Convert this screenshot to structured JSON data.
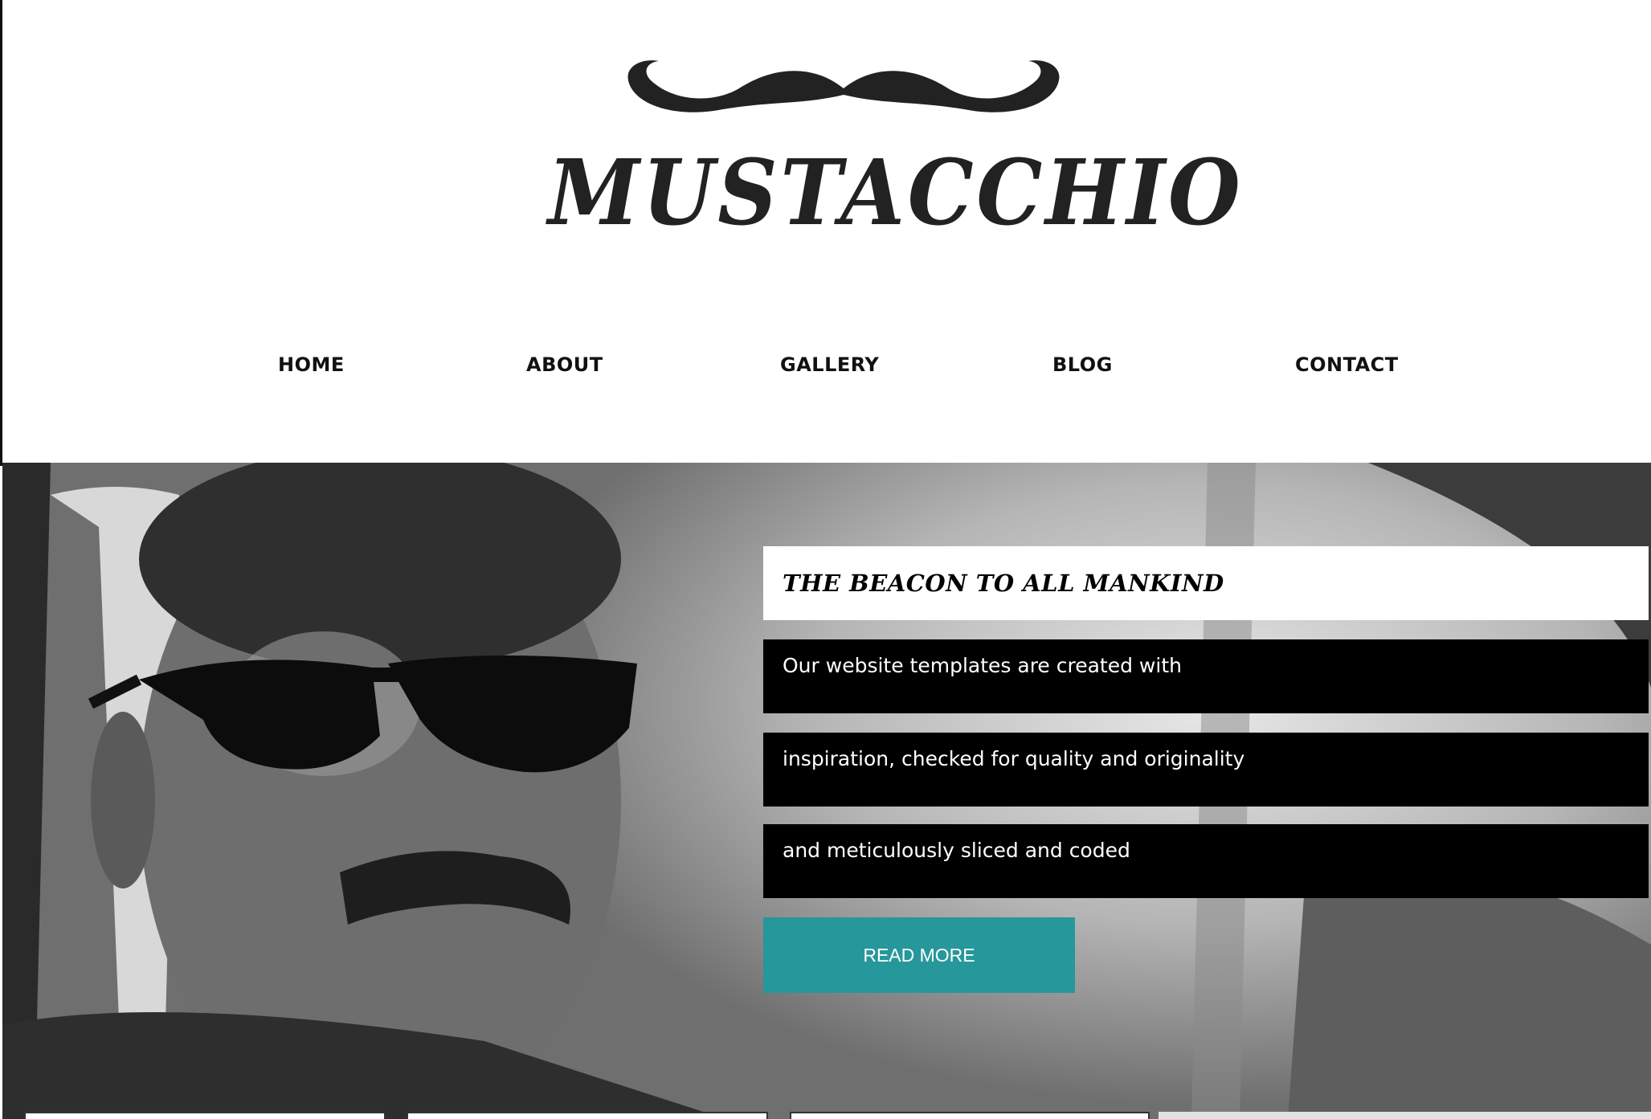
{
  "site": {
    "logo_text": "MUSTACCHIO"
  },
  "nav": {
    "items": [
      {
        "label": "HOME"
      },
      {
        "label": "ABOUT"
      },
      {
        "label": "GALLERY"
      },
      {
        "label": "BLOG"
      },
      {
        "label": "CONTACT"
      }
    ]
  },
  "hero": {
    "headline": "THE BEACON TO ALL MANKIND",
    "lines": [
      "Our website templates are created with",
      "inspiration, checked for quality and originality",
      "and meticulously sliced and coded"
    ],
    "cta_label": "READ MORE"
  },
  "colors": {
    "accent": "#26979b",
    "text_bar": "#000000",
    "headline_bg": "#ffffff"
  },
  "icons": {
    "logo_mark": "mustache-icon"
  }
}
